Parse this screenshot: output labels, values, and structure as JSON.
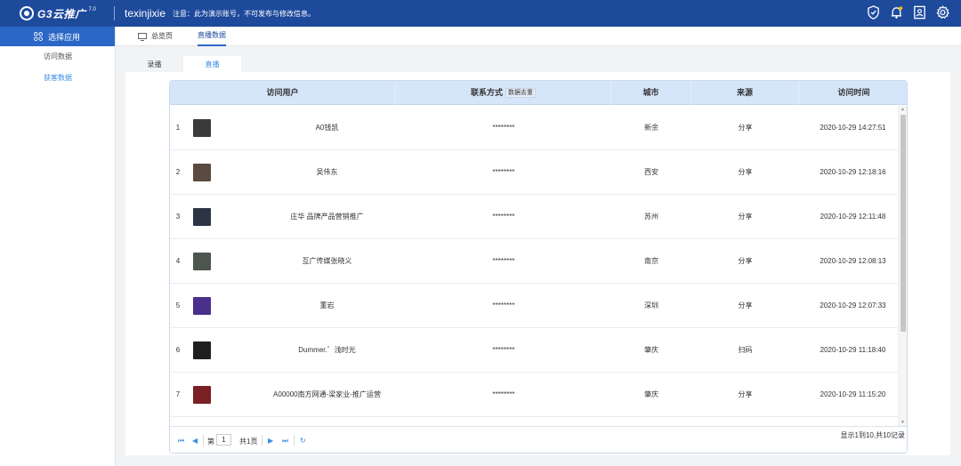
{
  "topbar": {
    "logo_text": "G3云推广",
    "logo_version": "7.0",
    "account": "texinjixie",
    "notice": "注意：此为演示账号，不可发布与修改信息。",
    "icons": [
      "shield-icon",
      "bell-icon",
      "id-card-icon",
      "gear-icon"
    ]
  },
  "sidebar": {
    "header": "选择应用",
    "items": [
      {
        "label": "访问数据",
        "active": false
      },
      {
        "label": "获客数据",
        "active": true
      }
    ]
  },
  "tabs": [
    {
      "label": "总览页",
      "icon": "monitor-icon",
      "active": false
    },
    {
      "label": "直播数据",
      "active": true
    }
  ],
  "subtabs": [
    {
      "label": "录播",
      "active": false
    },
    {
      "label": "直播",
      "active": true
    }
  ],
  "table": {
    "headers": {
      "user": "访问用户",
      "contact": "联系方式",
      "dedupe": "数据去重",
      "city": "城市",
      "source": "来源",
      "time": "访问时间"
    },
    "rows": [
      {
        "index": "1",
        "user": "A0钱凯",
        "contact": "********",
        "city": "新余",
        "source": "分享",
        "time": "2020-10-29 14:27:51",
        "avatar_color": "#3b3b3b"
      },
      {
        "index": "2",
        "user": "吴伟东",
        "contact": "********",
        "city": "西安",
        "source": "分享",
        "time": "2020-10-29 12:18:16",
        "avatar_color": "#5b4a3f"
      },
      {
        "index": "3",
        "user": "庄华 品牌产品营销推广",
        "contact": "********",
        "city": "苏州",
        "source": "分享",
        "time": "2020-10-29 12:11:48",
        "avatar_color": "#2c3446"
      },
      {
        "index": "4",
        "user": "互广传媒张晓义",
        "contact": "********",
        "city": "南京",
        "source": "分享",
        "time": "2020-10-29 12:08:13",
        "avatar_color": "#4c554e"
      },
      {
        "index": "5",
        "user": "董岩",
        "contact": "********",
        "city": "深圳",
        "source": "分享",
        "time": "2020-10-29 12:07:33",
        "avatar_color": "#4a2f8c"
      },
      {
        "index": "6",
        "user": "Dummer.゛浅时光",
        "contact": "********",
        "city": "肇庆",
        "source": "扫码",
        "time": "2020-10-29 11:18:40",
        "avatar_color": "#1f1f1f"
      },
      {
        "index": "7",
        "user": "A00000南方网通-梁家业-推广运营",
        "contact": "********",
        "city": "肇庆",
        "source": "分享",
        "time": "2020-10-29 11:15:20",
        "avatar_color": "#7a1f24"
      }
    ]
  },
  "pager": {
    "page_prefix": "第",
    "page_value": "1",
    "page_suffix": "共1页",
    "info": "显示1到10,共10记录"
  }
}
